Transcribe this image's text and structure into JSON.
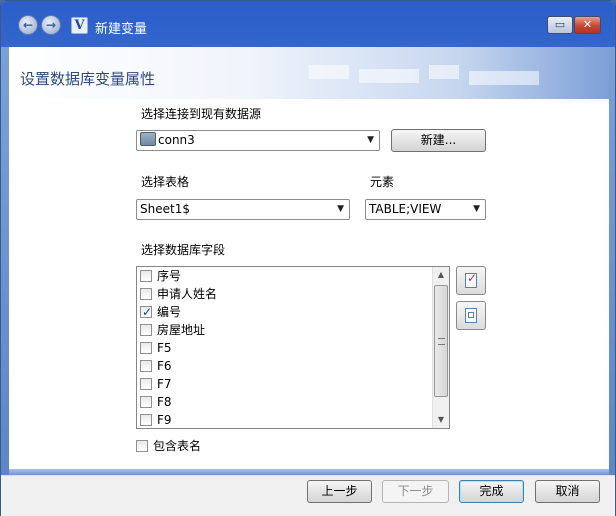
{
  "window": {
    "title": "新建变量",
    "logo_letter": "V",
    "back_glyph": "←",
    "forward_glyph": "→",
    "restore_glyph": "▭",
    "close_glyph": "✕"
  },
  "page": {
    "title": "设置数据库变量属性"
  },
  "datasource": {
    "label": "选择连接到现有数据源",
    "selected": "conn3",
    "new_button": "新建..."
  },
  "table": {
    "label": "选择表格",
    "selected": "Sheet1$"
  },
  "element": {
    "label": "元素",
    "selected": "TABLE;VIEW"
  },
  "fields": {
    "label": "选择数据库字段",
    "items": [
      {
        "label": "序号",
        "checked": false
      },
      {
        "label": "申请人姓名",
        "checked": false
      },
      {
        "label": "编号",
        "checked": true
      },
      {
        "label": "房屋地址",
        "checked": false
      },
      {
        "label": "F5",
        "checked": false
      },
      {
        "label": "F6",
        "checked": false
      },
      {
        "label": "F7",
        "checked": false
      },
      {
        "label": "F8",
        "checked": false
      },
      {
        "label": "F9",
        "checked": false
      }
    ]
  },
  "include_table_name": {
    "label": "包含表名",
    "checked": false
  },
  "footer": {
    "prev": "上一步",
    "next": "下一步",
    "finish": "完成",
    "cancel": "取消"
  },
  "icons": {
    "select_all": "select-all-icon",
    "clear_all": "clear-all-icon",
    "datasource": "database-icon",
    "dropdown": "chevron-down-icon"
  }
}
